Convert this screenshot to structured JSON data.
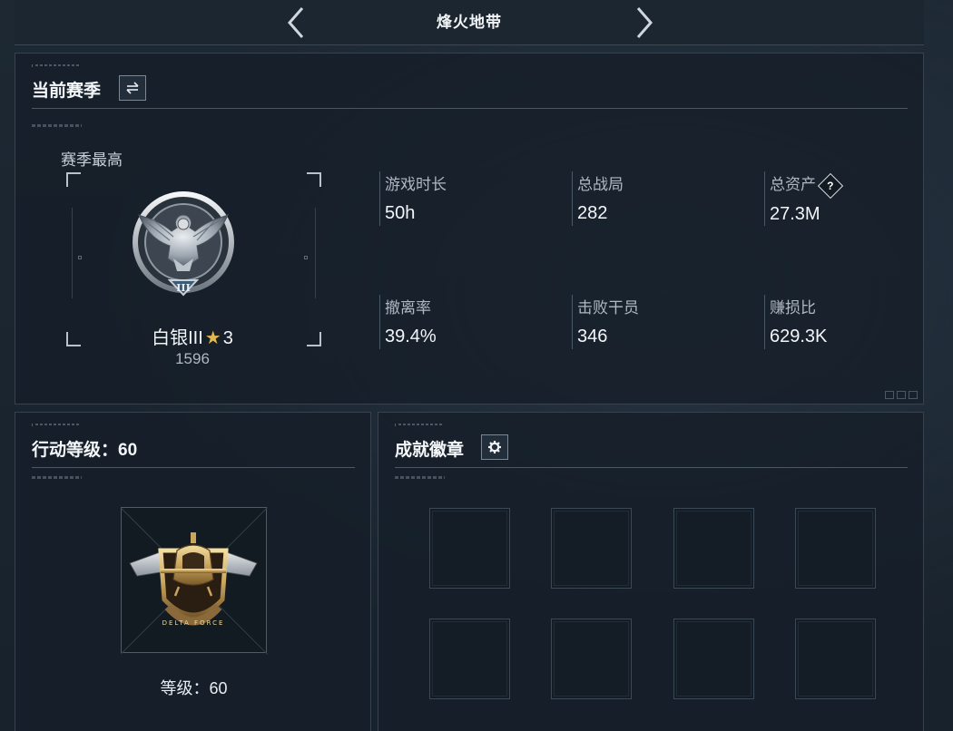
{
  "header": {
    "title": "烽火地带",
    "prev_icon": "chevron-left-icon",
    "next_icon": "chevron-right-icon"
  },
  "season": {
    "title": "当前赛季",
    "switch_icon": "swap-icon",
    "best_label": "赛季最高",
    "rank_name": "白银III",
    "rank_star_icon": "star-icon",
    "rank_stars": "3",
    "rank_score": "1596",
    "stats": [
      {
        "label": "游戏时长",
        "value": "50h"
      },
      {
        "label": "总战局",
        "value": "282"
      },
      {
        "label": "总资产",
        "value": "27.3M",
        "help": "?"
      },
      {
        "label": "撤离率",
        "value": "39.4%"
      },
      {
        "label": "击败干员",
        "value": "346"
      },
      {
        "label": "赚损比",
        "value": "629.3K"
      }
    ]
  },
  "level": {
    "title": "行动等级：60",
    "caption": "等级：60"
  },
  "achievements": {
    "title": "成就徽章",
    "settings_icon": "gear-icon",
    "slot_count": 8
  },
  "colors": {
    "accent_gold": "#e4b74d",
    "panel_border": "#36434f",
    "text_primary": "#f2f5f8",
    "text_secondary": "#aeb8c2"
  }
}
